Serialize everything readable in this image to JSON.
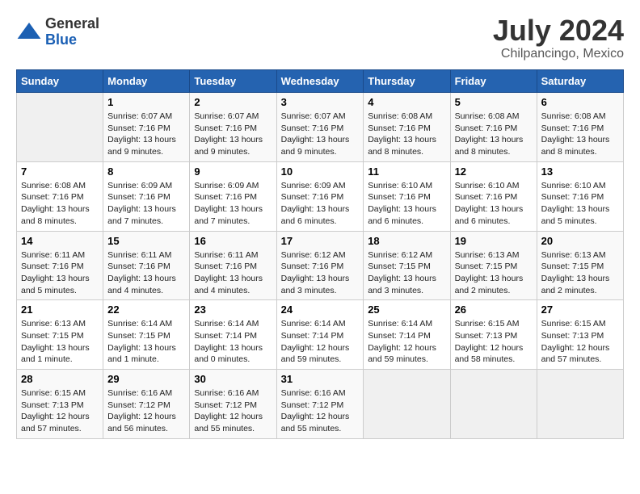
{
  "header": {
    "logo_general": "General",
    "logo_blue": "Blue",
    "month_year": "July 2024",
    "location": "Chilpancingo, Mexico"
  },
  "days_of_week": [
    "Sunday",
    "Monday",
    "Tuesday",
    "Wednesday",
    "Thursday",
    "Friday",
    "Saturday"
  ],
  "weeks": [
    [
      {
        "day": "",
        "info": ""
      },
      {
        "day": "1",
        "info": "Sunrise: 6:07 AM\nSunset: 7:16 PM\nDaylight: 13 hours\nand 9 minutes."
      },
      {
        "day": "2",
        "info": "Sunrise: 6:07 AM\nSunset: 7:16 PM\nDaylight: 13 hours\nand 9 minutes."
      },
      {
        "day": "3",
        "info": "Sunrise: 6:07 AM\nSunset: 7:16 PM\nDaylight: 13 hours\nand 9 minutes."
      },
      {
        "day": "4",
        "info": "Sunrise: 6:08 AM\nSunset: 7:16 PM\nDaylight: 13 hours\nand 8 minutes."
      },
      {
        "day": "5",
        "info": "Sunrise: 6:08 AM\nSunset: 7:16 PM\nDaylight: 13 hours\nand 8 minutes."
      },
      {
        "day": "6",
        "info": "Sunrise: 6:08 AM\nSunset: 7:16 PM\nDaylight: 13 hours\nand 8 minutes."
      }
    ],
    [
      {
        "day": "7",
        "info": "Sunrise: 6:08 AM\nSunset: 7:16 PM\nDaylight: 13 hours\nand 8 minutes."
      },
      {
        "day": "8",
        "info": "Sunrise: 6:09 AM\nSunset: 7:16 PM\nDaylight: 13 hours\nand 7 minutes."
      },
      {
        "day": "9",
        "info": "Sunrise: 6:09 AM\nSunset: 7:16 PM\nDaylight: 13 hours\nand 7 minutes."
      },
      {
        "day": "10",
        "info": "Sunrise: 6:09 AM\nSunset: 7:16 PM\nDaylight: 13 hours\nand 6 minutes."
      },
      {
        "day": "11",
        "info": "Sunrise: 6:10 AM\nSunset: 7:16 PM\nDaylight: 13 hours\nand 6 minutes."
      },
      {
        "day": "12",
        "info": "Sunrise: 6:10 AM\nSunset: 7:16 PM\nDaylight: 13 hours\nand 6 minutes."
      },
      {
        "day": "13",
        "info": "Sunrise: 6:10 AM\nSunset: 7:16 PM\nDaylight: 13 hours\nand 5 minutes."
      }
    ],
    [
      {
        "day": "14",
        "info": "Sunrise: 6:11 AM\nSunset: 7:16 PM\nDaylight: 13 hours\nand 5 minutes."
      },
      {
        "day": "15",
        "info": "Sunrise: 6:11 AM\nSunset: 7:16 PM\nDaylight: 13 hours\nand 4 minutes."
      },
      {
        "day": "16",
        "info": "Sunrise: 6:11 AM\nSunset: 7:16 PM\nDaylight: 13 hours\nand 4 minutes."
      },
      {
        "day": "17",
        "info": "Sunrise: 6:12 AM\nSunset: 7:16 PM\nDaylight: 13 hours\nand 3 minutes."
      },
      {
        "day": "18",
        "info": "Sunrise: 6:12 AM\nSunset: 7:15 PM\nDaylight: 13 hours\nand 3 minutes."
      },
      {
        "day": "19",
        "info": "Sunrise: 6:13 AM\nSunset: 7:15 PM\nDaylight: 13 hours\nand 2 minutes."
      },
      {
        "day": "20",
        "info": "Sunrise: 6:13 AM\nSunset: 7:15 PM\nDaylight: 13 hours\nand 2 minutes."
      }
    ],
    [
      {
        "day": "21",
        "info": "Sunrise: 6:13 AM\nSunset: 7:15 PM\nDaylight: 13 hours\nand 1 minute."
      },
      {
        "day": "22",
        "info": "Sunrise: 6:14 AM\nSunset: 7:15 PM\nDaylight: 13 hours\nand 1 minute."
      },
      {
        "day": "23",
        "info": "Sunrise: 6:14 AM\nSunset: 7:14 PM\nDaylight: 13 hours\nand 0 minutes."
      },
      {
        "day": "24",
        "info": "Sunrise: 6:14 AM\nSunset: 7:14 PM\nDaylight: 12 hours\nand 59 minutes."
      },
      {
        "day": "25",
        "info": "Sunrise: 6:14 AM\nSunset: 7:14 PM\nDaylight: 12 hours\nand 59 minutes."
      },
      {
        "day": "26",
        "info": "Sunrise: 6:15 AM\nSunset: 7:13 PM\nDaylight: 12 hours\nand 58 minutes."
      },
      {
        "day": "27",
        "info": "Sunrise: 6:15 AM\nSunset: 7:13 PM\nDaylight: 12 hours\nand 57 minutes."
      }
    ],
    [
      {
        "day": "28",
        "info": "Sunrise: 6:15 AM\nSunset: 7:13 PM\nDaylight: 12 hours\nand 57 minutes."
      },
      {
        "day": "29",
        "info": "Sunrise: 6:16 AM\nSunset: 7:12 PM\nDaylight: 12 hours\nand 56 minutes."
      },
      {
        "day": "30",
        "info": "Sunrise: 6:16 AM\nSunset: 7:12 PM\nDaylight: 12 hours\nand 55 minutes."
      },
      {
        "day": "31",
        "info": "Sunrise: 6:16 AM\nSunset: 7:12 PM\nDaylight: 12 hours\nand 55 minutes."
      },
      {
        "day": "",
        "info": ""
      },
      {
        "day": "",
        "info": ""
      },
      {
        "day": "",
        "info": ""
      }
    ]
  ]
}
